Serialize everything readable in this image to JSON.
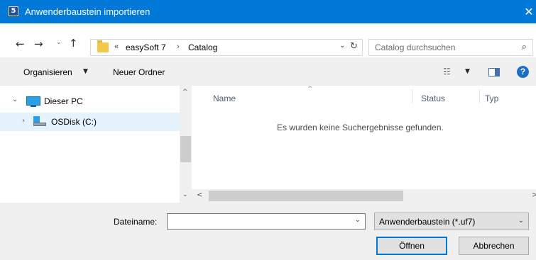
{
  "window": {
    "title": "Anwenderbaustein importieren",
    "close_glyph": "✕",
    "app_icon_glyph": "5"
  },
  "nav": {
    "back_glyph": "←",
    "forward_glyph": "→",
    "recent_glyph": "⌄",
    "up_glyph": "↑",
    "breadcrumb_overflow": "«",
    "breadcrumb": [
      "easySoft 7",
      "Catalog"
    ],
    "breadcrumb_separator": "›",
    "address_dropdown_glyph": "⌄",
    "refresh_glyph": "↻",
    "search_placeholder": "Catalog durchsuchen",
    "search_glyph": "⌕"
  },
  "toolbar": {
    "organize_label": "Organisieren",
    "organize_arrow": "▼",
    "new_folder_label": "Neuer Ordner",
    "view_glyph": "☷",
    "view_arrow": "▼",
    "help_glyph": "?"
  },
  "tree": {
    "items": [
      {
        "label": "Dieser PC",
        "expander": "⌄",
        "icon": "computer-icon"
      },
      {
        "label": "OSDisk (C:)",
        "expander": "›",
        "icon": "drive-icon"
      }
    ]
  },
  "filelist": {
    "columns": [
      "Name",
      "Status",
      "Typ"
    ],
    "sort_glyph": "^",
    "empty_message": "Es wurden keine Suchergebnisse gefunden."
  },
  "scroll": {
    "up_glyph": "^",
    "down_glyph": "⌄",
    "left_glyph": "<",
    "right_glyph": ">"
  },
  "footer": {
    "filename_label": "Dateiname:",
    "filename_value": "",
    "filename_dropdown_glyph": "⌄",
    "filetype_value": "Anwenderbaustein (*.uf7)",
    "filetype_dropdown_glyph": "⌄",
    "open_label": "Öffnen",
    "cancel_label": "Abbrechen"
  },
  "colors": {
    "titlebar": "#0078d7",
    "selection": "#e5f3ff",
    "toolbar_bg": "#f0f0f0",
    "help_icon": "#1c6fc6"
  }
}
